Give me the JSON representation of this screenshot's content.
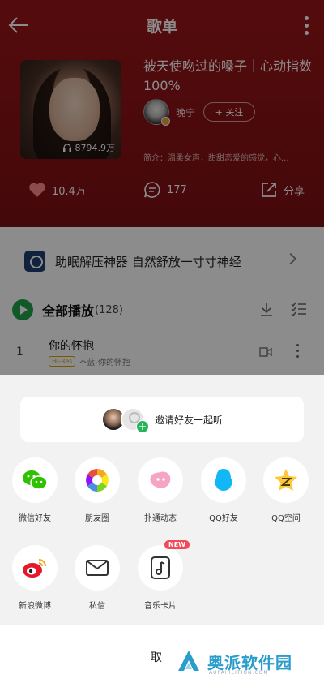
{
  "header": {
    "title": "歌单",
    "playlist_title": "被天使吻过的嗓子｜心动指数100%",
    "play_count": "8794.9万",
    "creator_name": "晚宁",
    "follow_label": "+ 关注",
    "description": "简介：温柔女声，甜甜恋爱的感觉，心..."
  },
  "actions": {
    "likes": "10.4万",
    "comments": "177",
    "share": "分享"
  },
  "banner": {
    "text": "助眠解压神器 自然舒放一寸寸神经"
  },
  "playall": {
    "label": "全部播放",
    "count": "(128)"
  },
  "song": {
    "index": "1",
    "name": "你的怀抱",
    "badge": "Hi-Res",
    "sub": "不蓝-你的怀抱"
  },
  "sheet": {
    "invite_label": "邀请好友一起听",
    "row1": [
      "微信好友",
      "朋友圈",
      "扑通动态",
      "QQ好友",
      "QQ空间"
    ],
    "row2": [
      "新浪微博",
      "私信",
      "音乐卡片"
    ],
    "new_badge": "NEW",
    "cancel": "取"
  },
  "watermark": {
    "text": "奥派软件园",
    "sub": "AUPAIRLITION.COM"
  },
  "colors": {
    "header_bg": "#8a1216",
    "accent_green": "#26b35a",
    "wechat": "#2dc100",
    "qq": "#12b7f5",
    "weibo": "#e6162d"
  }
}
